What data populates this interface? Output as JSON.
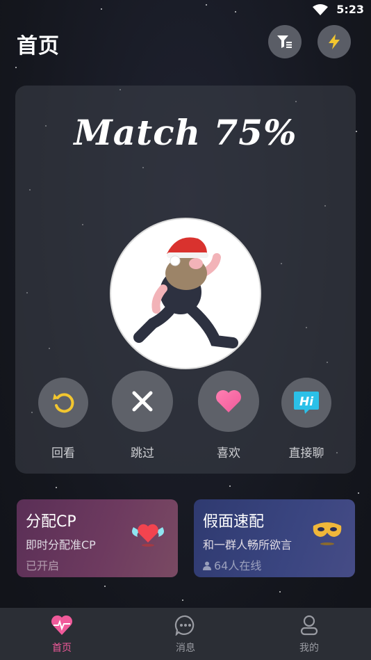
{
  "status_bar": {
    "time": "5:23"
  },
  "header": {
    "title": "首页"
  },
  "match": {
    "text": "Match 75%"
  },
  "actions": [
    {
      "label": "回看"
    },
    {
      "label": "跳过"
    },
    {
      "label": "喜欢"
    },
    {
      "label": "直接聊"
    }
  ],
  "features": [
    {
      "title": "分配CP",
      "subtitle": "即时分配准CP",
      "status": "已开启"
    },
    {
      "title": "假面速配",
      "subtitle": "和一群人畅所欲言",
      "status": "64人在线"
    }
  ],
  "bottom_nav": [
    {
      "label": "首页",
      "active": true
    },
    {
      "label": "消息",
      "active": false
    },
    {
      "label": "我的",
      "active": false
    }
  ],
  "colors": {
    "accent_pink": "#f05a9a",
    "undo_yellow": "#f2c62f",
    "hi_cyan": "#2bc0e8"
  }
}
